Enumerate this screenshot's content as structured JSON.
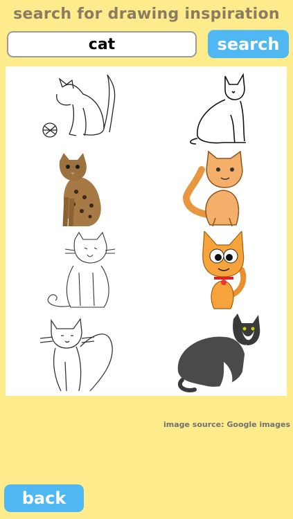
{
  "header": {
    "title": "search for drawing inspiration"
  },
  "search": {
    "value": "cat",
    "button_label": "search"
  },
  "results": {
    "items": [
      {
        "icon": "cat-sketch-ball-icon"
      },
      {
        "icon": "cat-sketch-sitting-icon"
      },
      {
        "icon": "cat-photo-bengal-icon"
      },
      {
        "icon": "cat-cartoon-orange-icon"
      },
      {
        "icon": "cat-sketch-fluffy-icon"
      },
      {
        "icon": "cat-cartoon-big-eyes-icon"
      },
      {
        "icon": "cat-sketch-long-tail-icon"
      },
      {
        "icon": "cat-gray-white-icon"
      }
    ]
  },
  "footer": {
    "source_text": "image source: Google images",
    "back_label": "back"
  },
  "colors": {
    "background": "#FDEB8C",
    "accent": "#4FB8F2",
    "title": "#8A7C60"
  }
}
